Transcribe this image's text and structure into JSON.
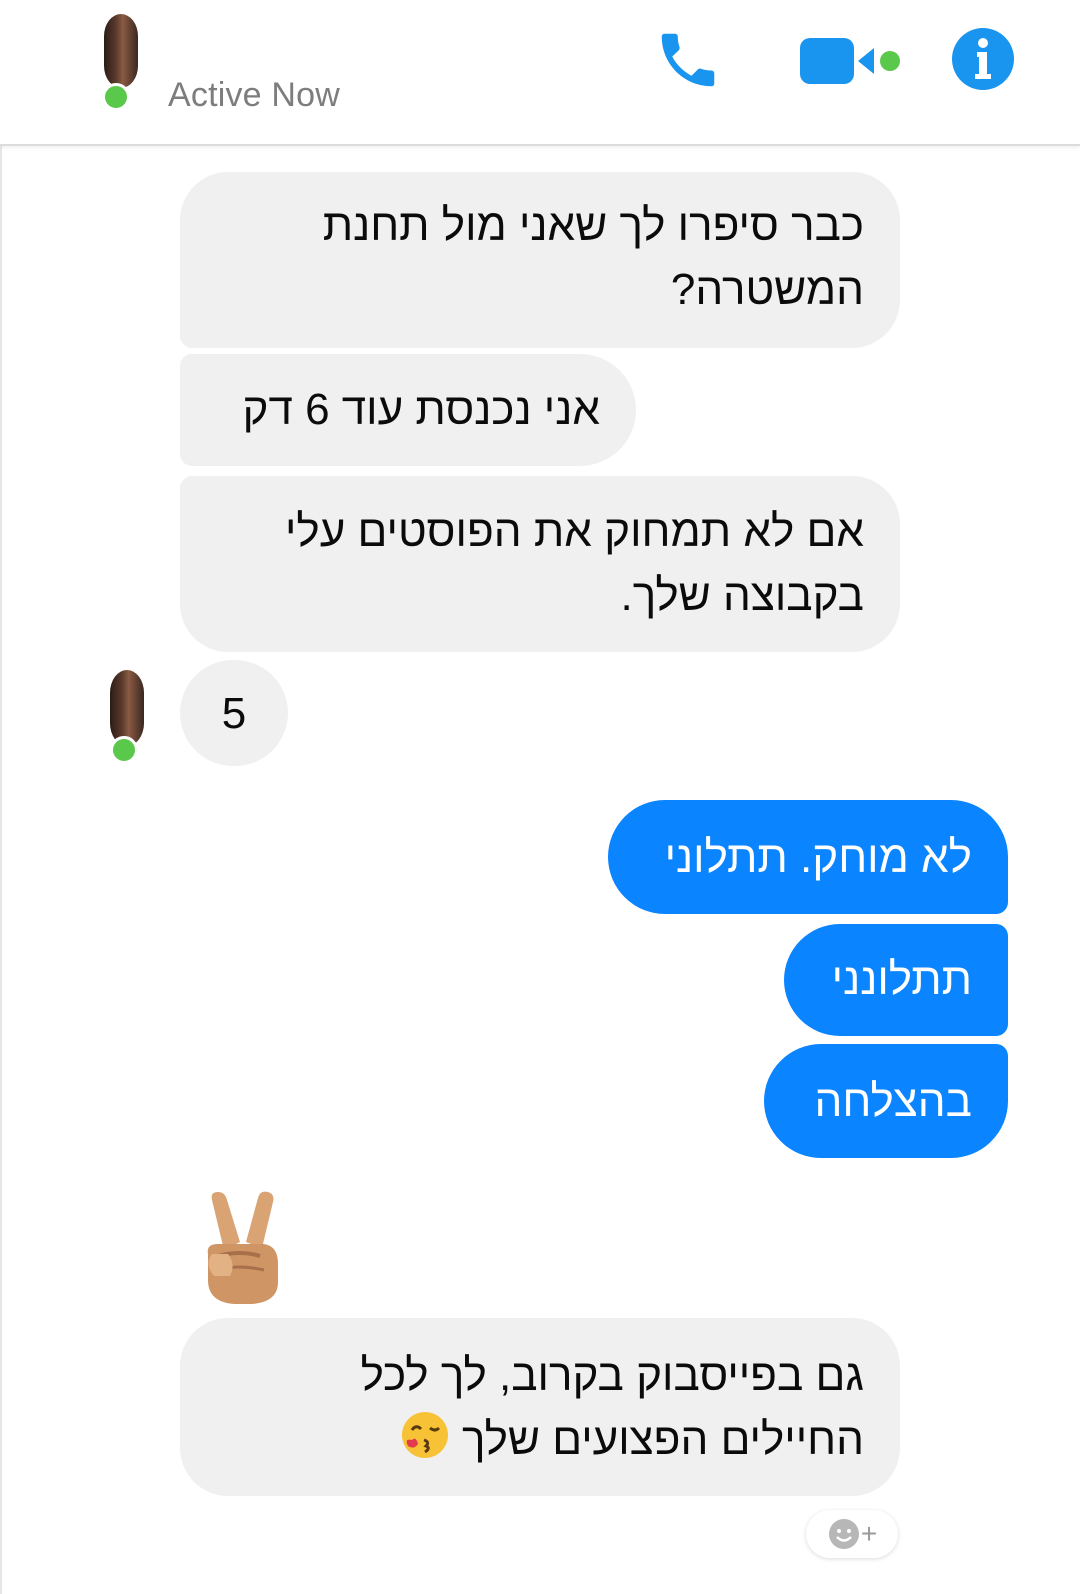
{
  "header": {
    "status": "Active Now",
    "icons": {
      "call": "phone-icon",
      "video": "video-call-icon",
      "info": "info-icon"
    }
  },
  "colors": {
    "accent": "#0b84ff",
    "header_icons": "#1a95ef",
    "online": "#5ac84a",
    "incoming_bubble": "#f0f0f0",
    "outgoing_bubble": "#0b84ff"
  },
  "messages": {
    "in1": "כבר סיפרו לך שאני מול תחנת המשטרה?",
    "in2": "אני נכנסת עוד 6 דק",
    "in3": "אם לא תמחוק את הפוסטים עלי בקבוצה שלך.",
    "in4": "5",
    "out1": "לא מוחק. תתלוני",
    "out2": "תתלונני",
    "out3": "בהצלחה",
    "emoji_msg": "victory-hand-emoji",
    "in5": "גם בפייסבוק בקרוב, לך לכל החיילים הפצועים שלך",
    "in5_emoji": "kissing-face-emoji"
  },
  "reaction_button": {
    "icon": "add-reaction-icon",
    "label": "+"
  }
}
